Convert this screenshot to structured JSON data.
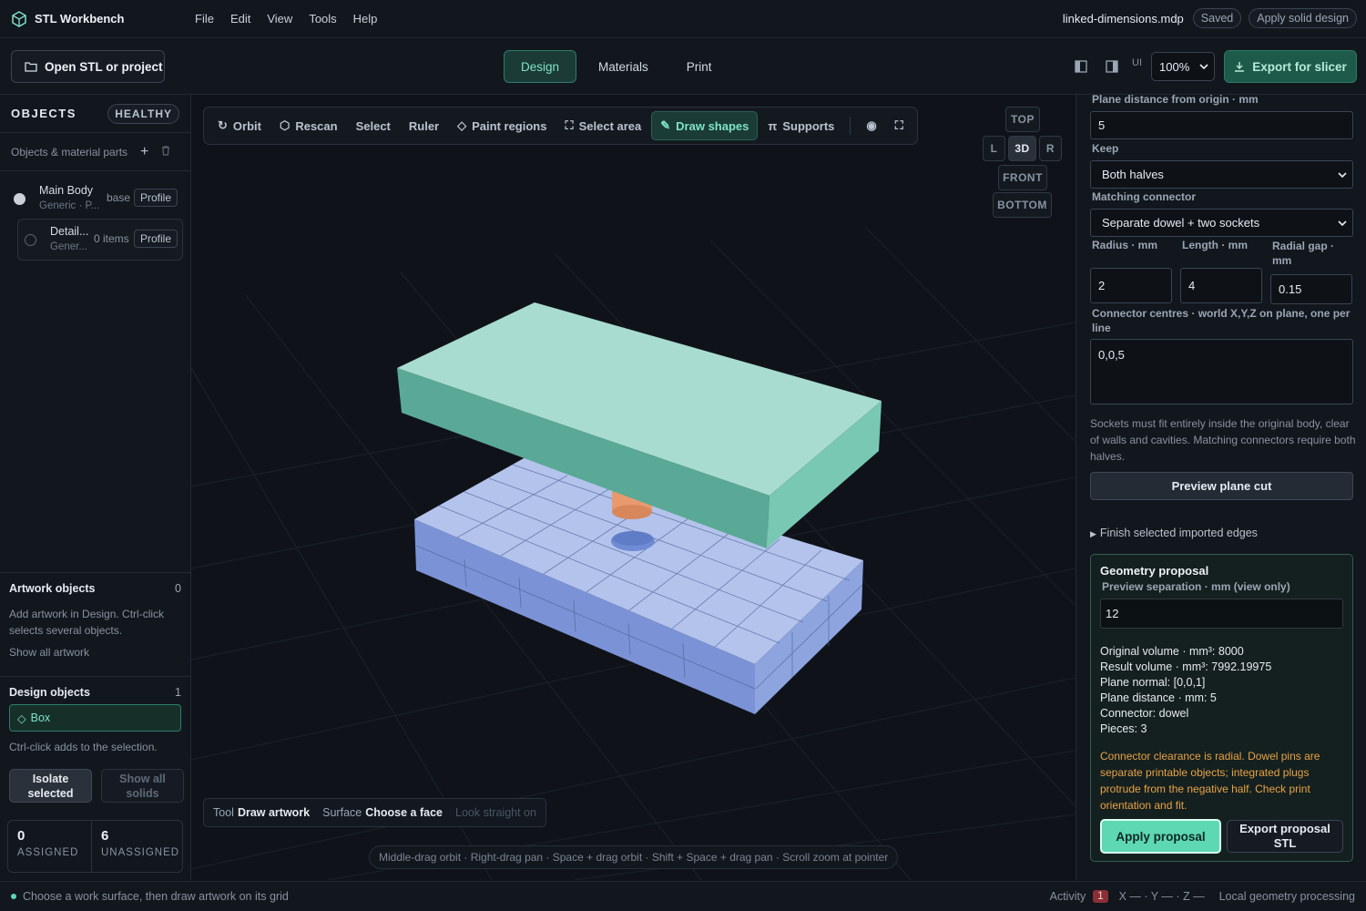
{
  "app": {
    "title": "STL Workbench",
    "menus": [
      "File",
      "Edit",
      "View",
      "Tools",
      "Help"
    ],
    "filename": "linked-dimensions.mdp",
    "saved_label": "Saved",
    "apply_solid_label": "Apply solid design"
  },
  "toolbar": {
    "open_label": "Open STL or project",
    "tabs": [
      "Design",
      "Materials",
      "Print"
    ],
    "active_tab": "Design",
    "ui_label": "UI",
    "zoom_value": "100%",
    "export_label": "Export for slicer"
  },
  "objects": {
    "title": "OBJECTS",
    "health": "HEALTHY",
    "subtitle": "Objects & material parts",
    "items": [
      {
        "name": "Main Body",
        "sub": "Generic · P...",
        "tag": "base",
        "profile": "Profile"
      },
      {
        "name": "Detail...",
        "sub": "Gener...",
        "tag": "0 items",
        "profile": "Profile"
      }
    ]
  },
  "artwork": {
    "title": "Artwork objects",
    "count": "0",
    "help": "Add artwork in Design. Ctrl-click selects several objects.",
    "show_all": "Show all artwork"
  },
  "design_objects": {
    "title": "Design objects",
    "count": "1",
    "item": "Box",
    "help": "Ctrl-click adds to the selection.",
    "isolate_label": "Isolate selected",
    "show_all_label": "Show all solids"
  },
  "counts": {
    "assigned_value": "0",
    "assigned_label": "ASSIGNED",
    "unassigned_value": "6",
    "unassigned_label": "UNASSIGNED"
  },
  "viewport": {
    "tools": [
      "Orbit",
      "Rescan",
      "Select",
      "Ruler",
      "Paint regions",
      "Select area",
      "Draw shapes",
      "Supports"
    ],
    "active_tool": "Draw shapes",
    "views": {
      "top": "TOP",
      "left": "L",
      "center": "3D",
      "right": "R",
      "front": "FRONT",
      "bottom": "BOTTOM"
    },
    "status": {
      "tool_label": "Tool",
      "tool_value": "Draw artwork",
      "surface_label": "Surface",
      "surface_value": "Choose a face",
      "look": "Look straight on"
    },
    "hint": "Middle-drag orbit · Right-drag pan · Space + drag orbit · Shift + Space + drag pan · Scroll zoom at pointer"
  },
  "panel": {
    "plane_distance_label": "Plane distance from origin · mm",
    "plane_distance_value": "5",
    "keep_label": "Keep",
    "keep_value": "Both halves",
    "connector_label": "Matching connector",
    "connector_value": "Separate dowel + two sockets",
    "radius_label": "Radius · mm",
    "radius_value": "2",
    "length_label": "Length · mm",
    "length_value": "4",
    "gap_label": "Radial gap · mm",
    "gap_value": "0.15",
    "centres_label": "Connector centres · world X,Y,Z on plane, one per line",
    "centres_value": "0,0,5",
    "help": "Sockets must fit entirely inside the original body, clear of walls and cavities. Matching connectors require both halves.",
    "preview_label": "Preview plane cut",
    "finish_label": "Finish selected imported edges"
  },
  "proposal": {
    "title": "Geometry proposal",
    "sep_label": "Preview separation · mm (view only)",
    "sep_value": "12",
    "stats": [
      "Original volume · mm³: 8000",
      "Result volume · mm³: 7992.19975",
      "Plane normal: [0,0,1]",
      "Plane distance · mm: 5",
      "Connector: dowel",
      "Pieces: 3"
    ],
    "warning": "Connector clearance is radial. Dowel pins are separate printable objects; integrated plugs protrude from the negative half. Check print orientation and fit.",
    "apply_label": "Apply proposal",
    "export_label": "Export proposal STL"
  },
  "statusbar": {
    "message": "Choose a work surface, then draw artwork on its grid",
    "activity_label": "Activity",
    "activity_count": "1",
    "coords": "X — · Y — · Z —",
    "processing": "Local geometry processing"
  },
  "colors": {
    "accent": "#5ed7b3",
    "top_piece": "#9fd8cb",
    "bottom_piece": "#a8b9e6",
    "dowel": "#e89a6e",
    "warning": "#e8a245"
  }
}
